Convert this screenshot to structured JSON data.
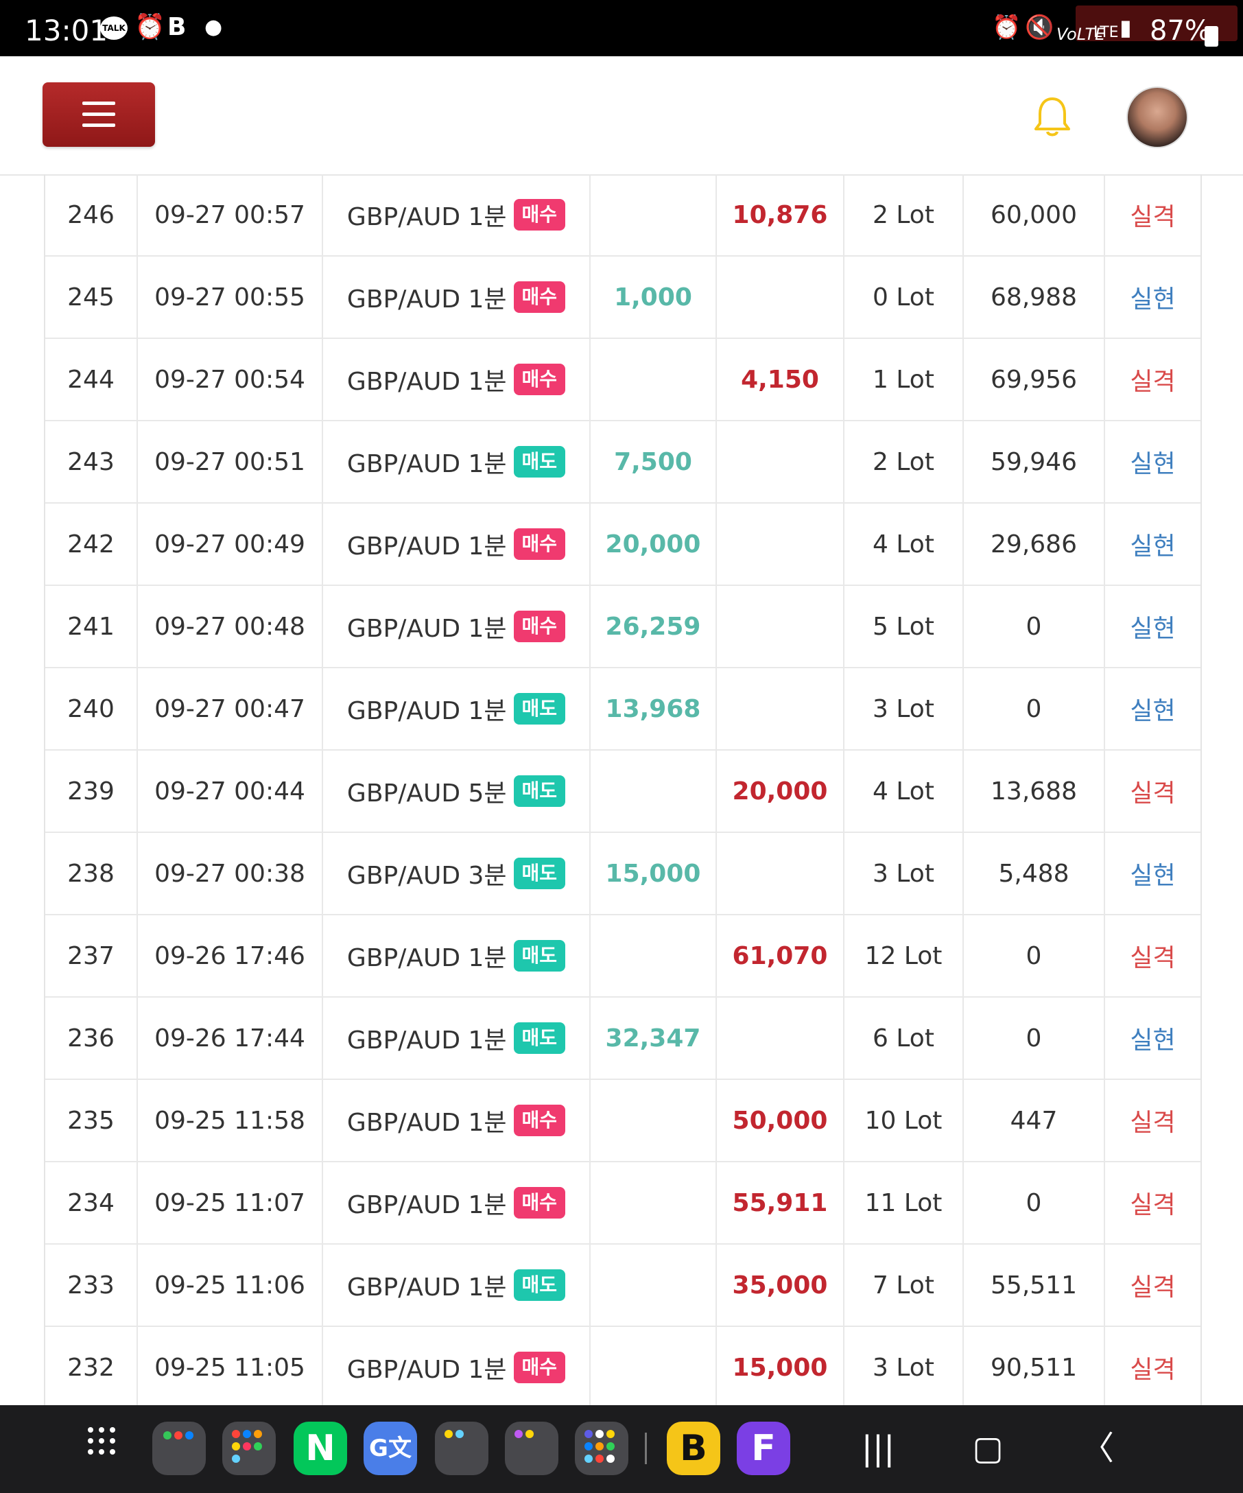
{
  "status_bar": {
    "time": "13:01",
    "talk_label": "TALK",
    "battery": "87%",
    "network": "LTE",
    "volte": "VoLTE",
    "icons": [
      "kakaotalk-icon",
      "alarm-app-icon",
      "b-app-icon",
      "dot-icon",
      "alarm-icon",
      "mute-icon",
      "volte-icon",
      "lte-icon",
      "signal-icon",
      "battery-icon"
    ]
  },
  "header": {
    "menu_icon": "hamburger-menu-icon",
    "bell_icon": "bell-icon",
    "avatar": "user-avatar",
    "colors": {
      "menu_button": "#a82222",
      "bell": "#f5c518"
    }
  },
  "table": {
    "rows": [
      {
        "id": "246",
        "datetime": "09-27 00:57",
        "symbol": "GBP/AUD 1분",
        "side": "매수",
        "side_type": "buy",
        "gain": "",
        "loss": "10,876",
        "lot": "2 Lot",
        "balance": "60,000",
        "result": "실격",
        "result_type": "fail"
      },
      {
        "id": "245",
        "datetime": "09-27 00:55",
        "symbol": "GBP/AUD 1분",
        "side": "매수",
        "side_type": "buy",
        "gain": "1,000",
        "loss": "",
        "lot": "0 Lot",
        "balance": "68,988",
        "result": "실현",
        "result_type": "ok"
      },
      {
        "id": "244",
        "datetime": "09-27 00:54",
        "symbol": "GBP/AUD 1분",
        "side": "매수",
        "side_type": "buy",
        "gain": "",
        "loss": "4,150",
        "lot": "1 Lot",
        "balance": "69,956",
        "result": "실격",
        "result_type": "fail"
      },
      {
        "id": "243",
        "datetime": "09-27 00:51",
        "symbol": "GBP/AUD 1분",
        "side": "매도",
        "side_type": "sell",
        "gain": "7,500",
        "loss": "",
        "lot": "2 Lot",
        "balance": "59,946",
        "result": "실현",
        "result_type": "ok"
      },
      {
        "id": "242",
        "datetime": "09-27 00:49",
        "symbol": "GBP/AUD 1분",
        "side": "매수",
        "side_type": "buy",
        "gain": "20,000",
        "loss": "",
        "lot": "4 Lot",
        "balance": "29,686",
        "result": "실현",
        "result_type": "ok"
      },
      {
        "id": "241",
        "datetime": "09-27 00:48",
        "symbol": "GBP/AUD 1분",
        "side": "매수",
        "side_type": "buy",
        "gain": "26,259",
        "loss": "",
        "lot": "5 Lot",
        "balance": "0",
        "result": "실현",
        "result_type": "ok"
      },
      {
        "id": "240",
        "datetime": "09-27 00:47",
        "symbol": "GBP/AUD 1분",
        "side": "매도",
        "side_type": "sell",
        "gain": "13,968",
        "loss": "",
        "lot": "3 Lot",
        "balance": "0",
        "result": "실현",
        "result_type": "ok"
      },
      {
        "id": "239",
        "datetime": "09-27 00:44",
        "symbol": "GBP/AUD 5분",
        "side": "매도",
        "side_type": "sell",
        "gain": "",
        "loss": "20,000",
        "lot": "4 Lot",
        "balance": "13,688",
        "result": "실격",
        "result_type": "fail"
      },
      {
        "id": "238",
        "datetime": "09-27 00:38",
        "symbol": "GBP/AUD 3분",
        "side": "매도",
        "side_type": "sell",
        "gain": "15,000",
        "loss": "",
        "lot": "3 Lot",
        "balance": "5,488",
        "result": "실현",
        "result_type": "ok"
      },
      {
        "id": "237",
        "datetime": "09-26 17:46",
        "symbol": "GBP/AUD 1분",
        "side": "매도",
        "side_type": "sell",
        "gain": "",
        "loss": "61,070",
        "lot": "12 Lot",
        "balance": "0",
        "result": "실격",
        "result_type": "fail"
      },
      {
        "id": "236",
        "datetime": "09-26 17:44",
        "symbol": "GBP/AUD 1분",
        "side": "매도",
        "side_type": "sell",
        "gain": "32,347",
        "loss": "",
        "lot": "6 Lot",
        "balance": "0",
        "result": "실현",
        "result_type": "ok"
      },
      {
        "id": "235",
        "datetime": "09-25 11:58",
        "symbol": "GBP/AUD 1분",
        "side": "매수",
        "side_type": "buy",
        "gain": "",
        "loss": "50,000",
        "lot": "10 Lot",
        "balance": "447",
        "result": "실격",
        "result_type": "fail"
      },
      {
        "id": "234",
        "datetime": "09-25 11:07",
        "symbol": "GBP/AUD 1분",
        "side": "매수",
        "side_type": "buy",
        "gain": "",
        "loss": "55,911",
        "lot": "11 Lot",
        "balance": "0",
        "result": "실격",
        "result_type": "fail"
      },
      {
        "id": "233",
        "datetime": "09-25 11:06",
        "symbol": "GBP/AUD 1분",
        "side": "매도",
        "side_type": "sell",
        "gain": "",
        "loss": "35,000",
        "lot": "7 Lot",
        "balance": "55,511",
        "result": "실격",
        "result_type": "fail"
      },
      {
        "id": "232",
        "datetime": "09-25 11:05",
        "symbol": "GBP/AUD 1분",
        "side": "매수",
        "side_type": "buy",
        "gain": "",
        "loss": "15,000",
        "lot": "3 Lot",
        "balance": "90,511",
        "result": "실격",
        "result_type": "fail"
      }
    ],
    "colors": {
      "buy_badge": "#f03a6f",
      "sell_badge": "#1ec7ad",
      "gain": "#58b8a8",
      "loss": "#c2262f",
      "result_fail": "#d94a4a",
      "result_ok": "#3f7fbf"
    }
  },
  "nav_bar": {
    "apps": [
      "app-drawer-icon",
      "folder-1-icon",
      "folder-2-icon",
      "naver-app-icon",
      "google-translate-icon",
      "folder-3-icon",
      "folder-4-icon",
      "folder-5-icon",
      "b-app-icon",
      "f-app-icon"
    ],
    "naver_label": "N",
    "translate_label": "G文",
    "b_label": "B",
    "f_label": "F",
    "recents_glyph": "|||",
    "home_glyph": "▢",
    "back_glyph": "〈"
  }
}
